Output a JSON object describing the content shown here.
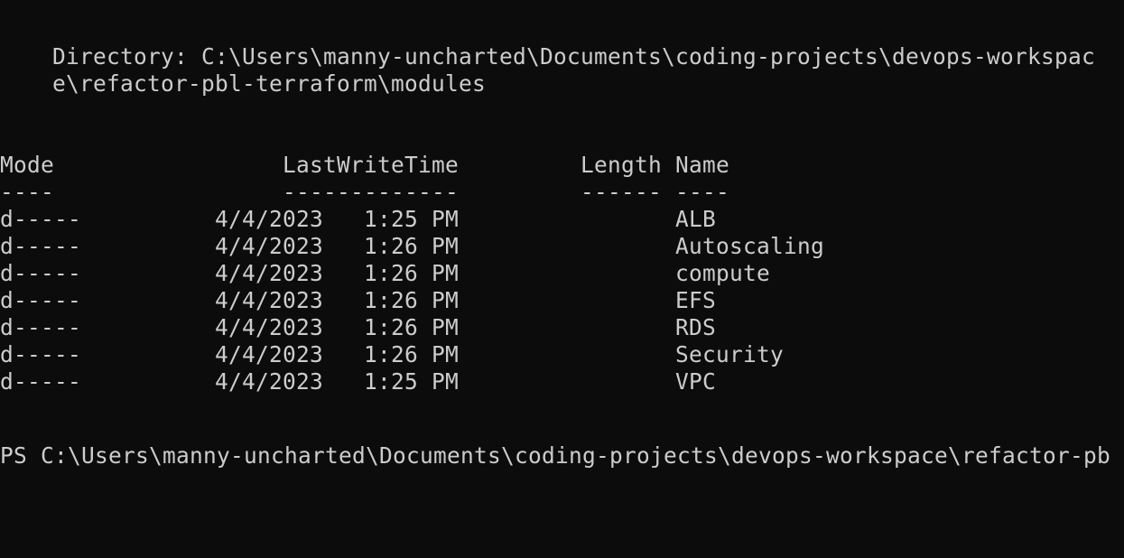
{
  "directory": {
    "line1": "Directory: C:\\Users\\manny-uncharted\\Documents\\coding-projects\\devops-workspac",
    "line2": "e\\refactor-pbl-terraform\\modules"
  },
  "headers": {
    "mode": "Mode",
    "lastwritetime": "LastWriteTime",
    "length": "Length",
    "name": "Name"
  },
  "underlines": {
    "mode": "----",
    "lastwritetime": "-------------",
    "length": "------",
    "name": "----"
  },
  "rows": [
    {
      "mode": "d-----",
      "date": "4/4/2023",
      "time": "1:25 PM",
      "length": "",
      "name": "ALB"
    },
    {
      "mode": "d-----",
      "date": "4/4/2023",
      "time": "1:26 PM",
      "length": "",
      "name": "Autoscaling"
    },
    {
      "mode": "d-----",
      "date": "4/4/2023",
      "time": "1:26 PM",
      "length": "",
      "name": "compute"
    },
    {
      "mode": "d-----",
      "date": "4/4/2023",
      "time": "1:26 PM",
      "length": "",
      "name": "EFS"
    },
    {
      "mode": "d-----",
      "date": "4/4/2023",
      "time": "1:26 PM",
      "length": "",
      "name": "RDS"
    },
    {
      "mode": "d-----",
      "date": "4/4/2023",
      "time": "1:26 PM",
      "length": "",
      "name": "Security"
    },
    {
      "mode": "d-----",
      "date": "4/4/2023",
      "time": "1:25 PM",
      "length": "",
      "name": "VPC"
    }
  ],
  "prompt": "PS C:\\Users\\manny-uncharted\\Documents\\coding-projects\\devops-workspace\\refactor-pb",
  "colors": {
    "background": "#0c0c0c",
    "foreground": "#cccccc"
  }
}
